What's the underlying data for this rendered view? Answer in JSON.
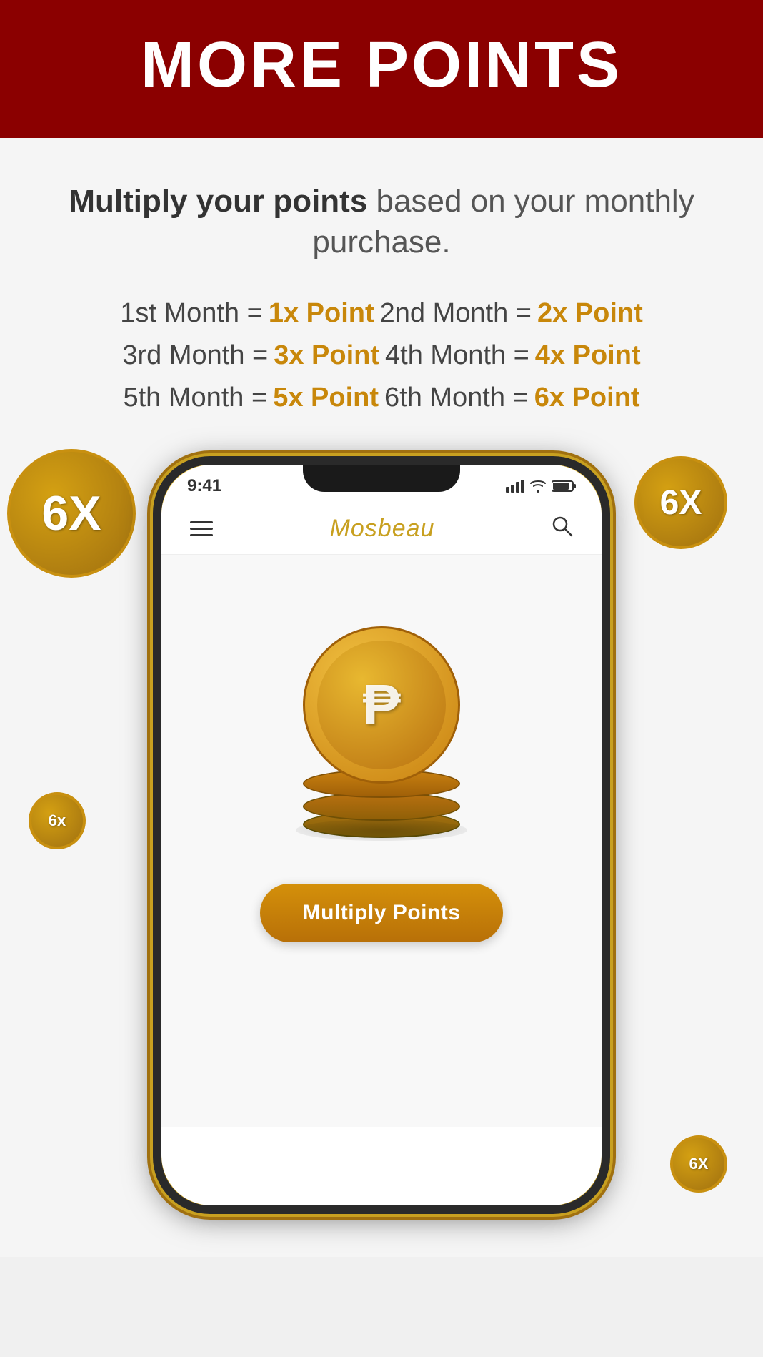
{
  "header": {
    "title": "MORE POINTS"
  },
  "subtitle": {
    "bold_part": "Multiply your points",
    "regular_part": " based on your monthly purchase."
  },
  "points_rows": [
    {
      "col1_label": "1st Month =",
      "col1_value": "1x Point",
      "col2_label": "2nd Month =",
      "col2_value": "2x Point"
    },
    {
      "col1_label": "3rd Month =",
      "col1_value": "3x Point",
      "col2_label": "4th Month  =",
      "col2_value": "4x Point"
    },
    {
      "col1_label": "5th Month =",
      "col1_value": "5x Point",
      "col2_label": "6th Month  =",
      "col2_value": "6x Point"
    }
  ],
  "badges": {
    "text": "6X"
  },
  "phone": {
    "time": "9:41",
    "logo": "Mosbeau",
    "coin_symbol": "₱",
    "multiply_button": "Multiply Points"
  }
}
